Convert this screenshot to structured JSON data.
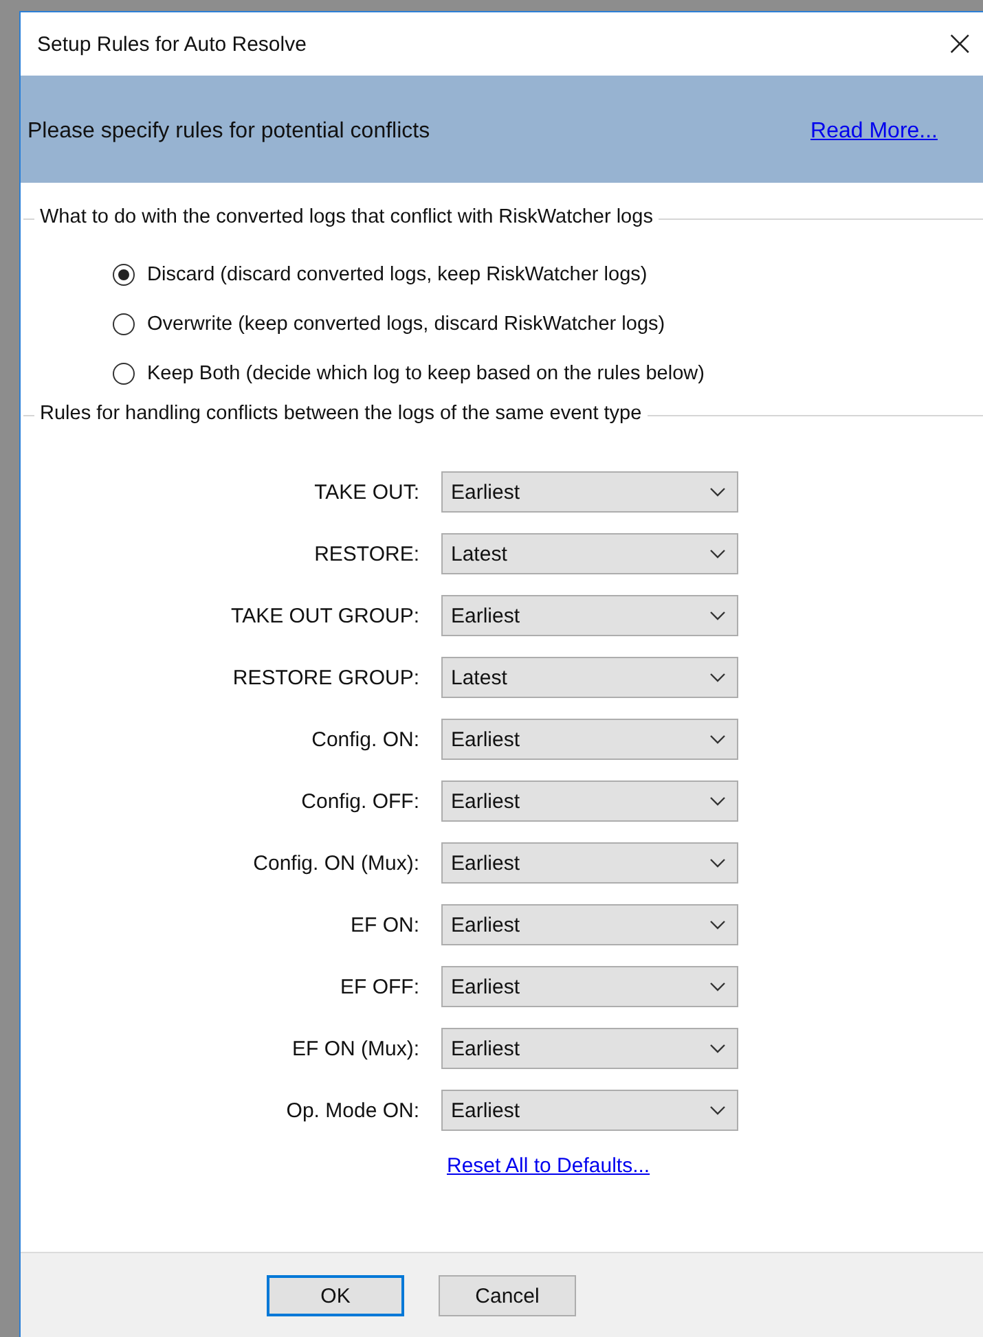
{
  "window": {
    "title": "Setup Rules for Auto Resolve",
    "close": "×"
  },
  "header": {
    "text": "Please specify rules for potential conflicts",
    "link": "Read More..."
  },
  "conflict_group": {
    "legend": "What to do with the converted logs that conflict with RiskWatcher logs",
    "options": [
      {
        "label": "Discard (discard converted logs, keep RiskWatcher logs)",
        "selected": true
      },
      {
        "label": "Overwrite (keep converted logs, discard RiskWatcher logs)",
        "selected": false
      },
      {
        "label": "Keep Both (decide which log to keep based on the rules below)",
        "selected": false
      }
    ]
  },
  "rules_group": {
    "legend": "Rules for handling conflicts between the logs of the same event type",
    "rules": [
      {
        "label": "TAKE OUT:",
        "value": "Earliest"
      },
      {
        "label": "RESTORE:",
        "value": "Latest"
      },
      {
        "label": "TAKE OUT GROUP:",
        "value": "Earliest"
      },
      {
        "label": "RESTORE GROUP:",
        "value": "Latest"
      },
      {
        "label": "Config. ON:",
        "value": "Earliest"
      },
      {
        "label": "Config. OFF:",
        "value": "Earliest"
      },
      {
        "label": "Config. ON (Mux):",
        "value": "Earliest"
      },
      {
        "label": "EF ON:",
        "value": "Earliest"
      },
      {
        "label": "EF OFF:",
        "value": "Earliest"
      },
      {
        "label": "EF ON (Mux):",
        "value": "Earliest"
      },
      {
        "label": "Op. Mode ON:",
        "value": "Earliest"
      }
    ],
    "reset_link": "Reset All to Defaults..."
  },
  "buttons": [
    {
      "label": "OK",
      "default": true
    },
    {
      "label": "Cancel",
      "default": false
    }
  ]
}
